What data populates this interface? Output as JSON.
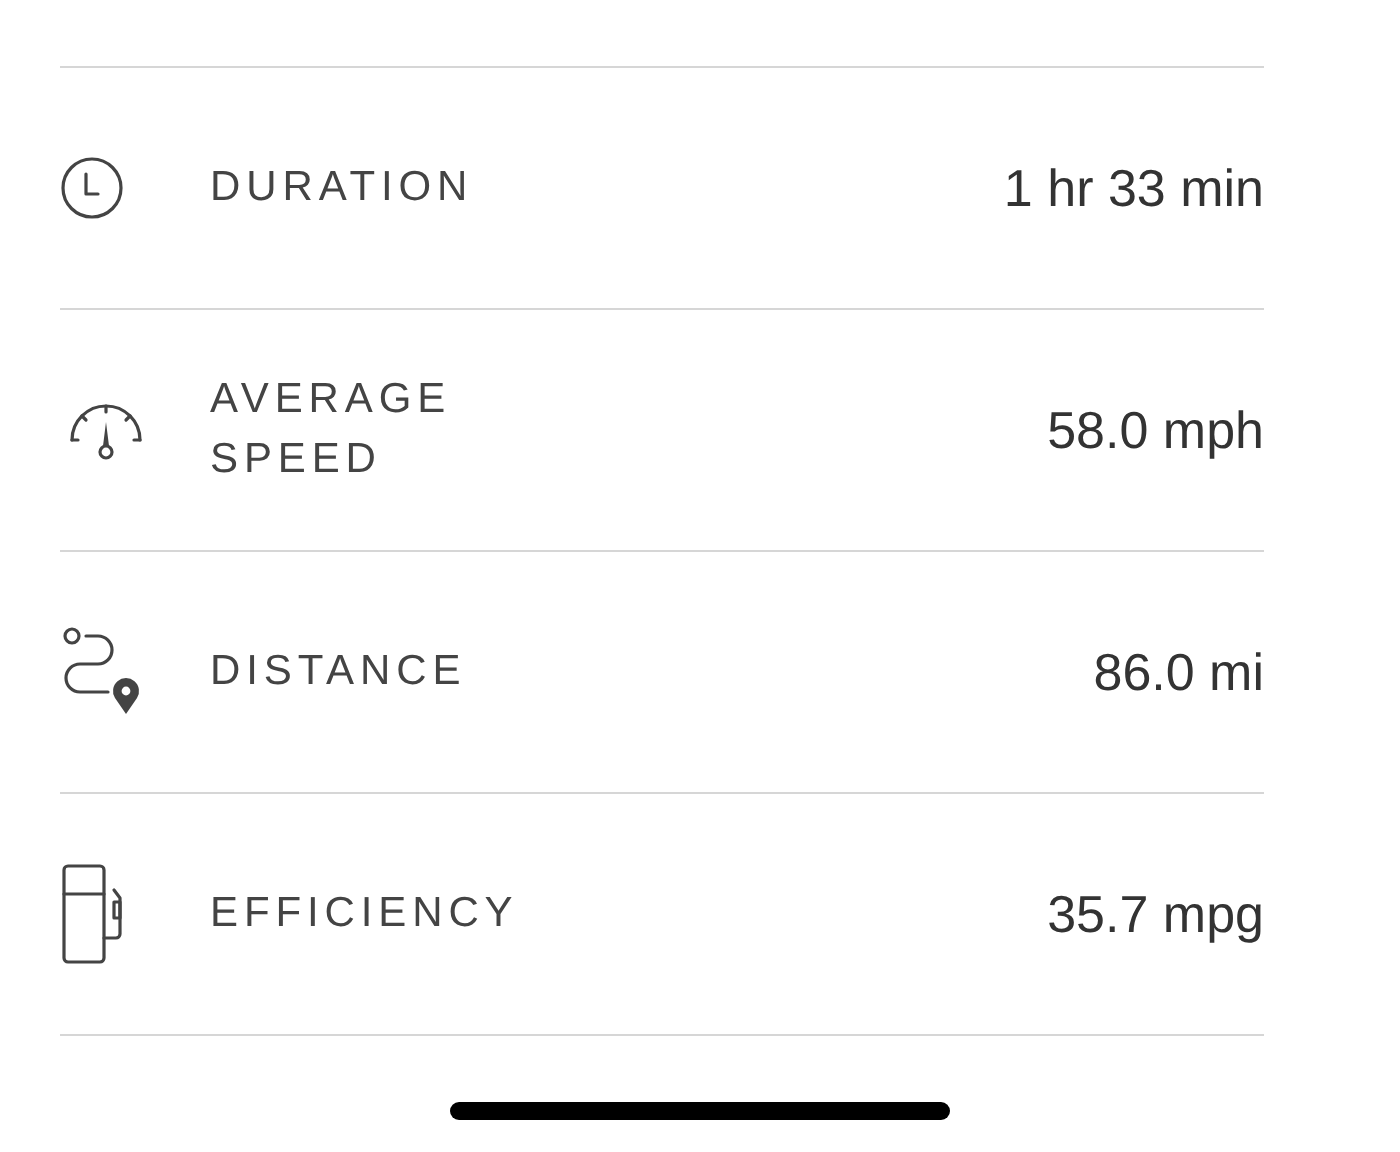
{
  "stats": [
    {
      "kind": "clock",
      "label": "DURATION",
      "value": "1 hr 33 min"
    },
    {
      "kind": "speedometer",
      "label": "AVERAGE SPEED",
      "value": "58.0 mph"
    },
    {
      "kind": "route",
      "label": "DISTANCE",
      "value": "86.0 mi"
    },
    {
      "kind": "fuel",
      "label": "EFFICIENCY",
      "value": "35.7 mpg"
    }
  ]
}
